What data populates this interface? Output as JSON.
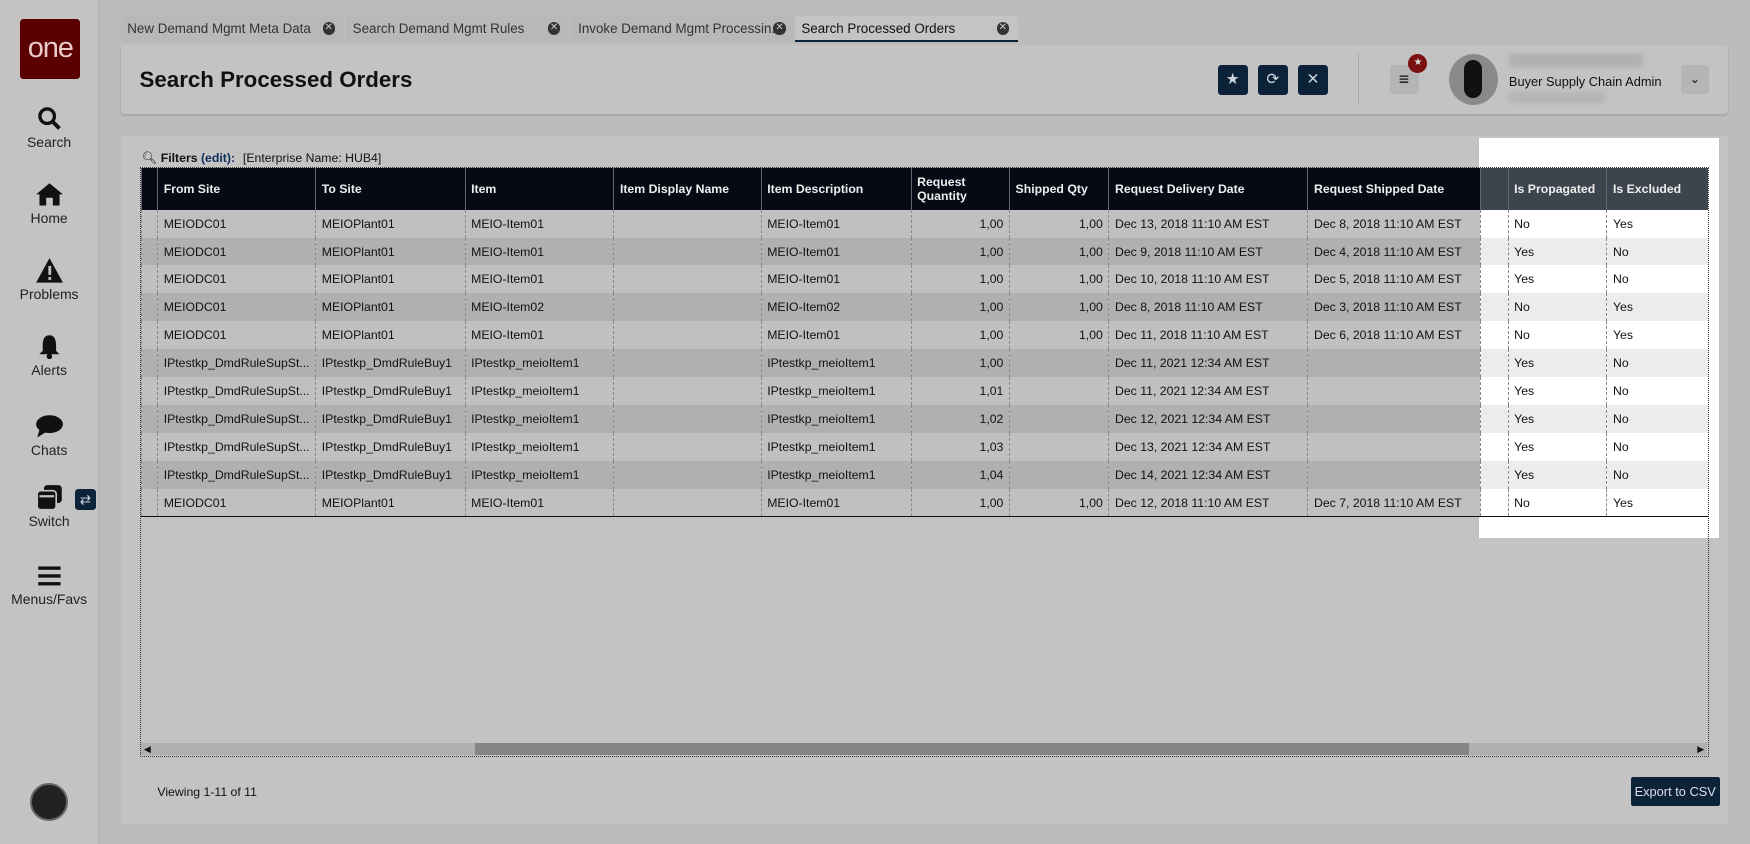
{
  "app": {
    "logo": "one"
  },
  "sidebar": {
    "items": [
      {
        "label": "Search",
        "icon": "search-icon"
      },
      {
        "label": "Home",
        "icon": "home-icon"
      },
      {
        "label": "Problems",
        "icon": "warning-icon"
      },
      {
        "label": "Alerts",
        "icon": "bell-icon"
      },
      {
        "label": "Chats",
        "icon": "chat-icon"
      },
      {
        "label": "Switch",
        "icon": "switch-icon"
      },
      {
        "label": "Menus/Favs",
        "icon": "menu-icon"
      }
    ]
  },
  "tabs": [
    {
      "label": "New Demand Mgmt Meta Data"
    },
    {
      "label": "Search Demand Mgmt Rules"
    },
    {
      "label": "Invoke Demand Mgmt Processin..."
    },
    {
      "label": "Search Processed Orders",
      "active": true
    }
  ],
  "header": {
    "title": "Search Processed Orders",
    "user_role": "Buyer Supply Chain Admin"
  },
  "filters": {
    "label": "Filters",
    "edit": "(edit):",
    "value": "[Enterprise Name: HUB4]"
  },
  "table": {
    "columns": [
      "From Site",
      "To Site",
      "Item",
      "Item Display Name",
      "Item Description",
      "Request Quantity",
      "Shipped Qty",
      "Request Delivery Date",
      "Request Shipped Date",
      "Is Propagated",
      "Is Excluded"
    ],
    "rows": [
      [
        "MEIODC01",
        "MEIOPlant01",
        "MEIO-Item01",
        "",
        "MEIO-Item01",
        "1,00",
        "1,00",
        "Dec 13, 2018 11:10 AM EST",
        "Dec 8, 2018 11:10 AM EST",
        "No",
        "Yes"
      ],
      [
        "MEIODC01",
        "MEIOPlant01",
        "MEIO-Item01",
        "",
        "MEIO-Item01",
        "1,00",
        "1,00",
        "Dec 9, 2018 11:10 AM EST",
        "Dec 4, 2018 11:10 AM EST",
        "Yes",
        "No"
      ],
      [
        "MEIODC01",
        "MEIOPlant01",
        "MEIO-Item01",
        "",
        "MEIO-Item01",
        "1,00",
        "1,00",
        "Dec 10, 2018 11:10 AM EST",
        "Dec 5, 2018 11:10 AM EST",
        "Yes",
        "No"
      ],
      [
        "MEIODC01",
        "MEIOPlant01",
        "MEIO-Item02",
        "",
        "MEIO-Item02",
        "1,00",
        "1,00",
        "Dec 8, 2018 11:10 AM EST",
        "Dec 3, 2018 11:10 AM EST",
        "No",
        "Yes"
      ],
      [
        "MEIODC01",
        "MEIOPlant01",
        "MEIO-Item01",
        "",
        "MEIO-Item01",
        "1,00",
        "1,00",
        "Dec 11, 2018 11:10 AM EST",
        "Dec 6, 2018 11:10 AM EST",
        "No",
        "Yes"
      ],
      [
        "IPtestkp_DmdRuleSupSt...",
        "IPtestkp_DmdRuleBuy1",
        "IPtestkp_meioItem1",
        "",
        "IPtestkp_meioItem1",
        "1,00",
        "",
        "Dec 11, 2021 12:34 AM EST",
        "",
        "Yes",
        "No"
      ],
      [
        "IPtestkp_DmdRuleSupSt...",
        "IPtestkp_DmdRuleBuy1",
        "IPtestkp_meioItem1",
        "",
        "IPtestkp_meioItem1",
        "1,01",
        "",
        "Dec 11, 2021 12:34 AM EST",
        "",
        "Yes",
        "No"
      ],
      [
        "IPtestkp_DmdRuleSupSt...",
        "IPtestkp_DmdRuleBuy1",
        "IPtestkp_meioItem1",
        "",
        "IPtestkp_meioItem1",
        "1,02",
        "",
        "Dec 12, 2021 12:34 AM EST",
        "",
        "Yes",
        "No"
      ],
      [
        "IPtestkp_DmdRuleSupSt...",
        "IPtestkp_DmdRuleBuy1",
        "IPtestkp_meioItem1",
        "",
        "IPtestkp_meioItem1",
        "1,03",
        "",
        "Dec 13, 2021 12:34 AM EST",
        "",
        "Yes",
        "No"
      ],
      [
        "IPtestkp_DmdRuleSupSt...",
        "IPtestkp_DmdRuleBuy1",
        "IPtestkp_meioItem1",
        "",
        "IPtestkp_meioItem1",
        "1,04",
        "",
        "Dec 14, 2021 12:34 AM EST",
        "",
        "Yes",
        "No"
      ],
      [
        "MEIODC01",
        "MEIOPlant01",
        "MEIO-Item01",
        "",
        "MEIO-Item01",
        "1,00",
        "1,00",
        "Dec 12, 2018 11:10 AM EST",
        "Dec 7, 2018 11:10 AM EST",
        "No",
        "Yes"
      ]
    ]
  },
  "footer": {
    "viewing": "Viewing 1-11 of 11",
    "export_label": "Export to CSV"
  },
  "colors": {
    "brand": "#5a0000",
    "navy": "#0b2239",
    "header_bg": "#050a14"
  }
}
